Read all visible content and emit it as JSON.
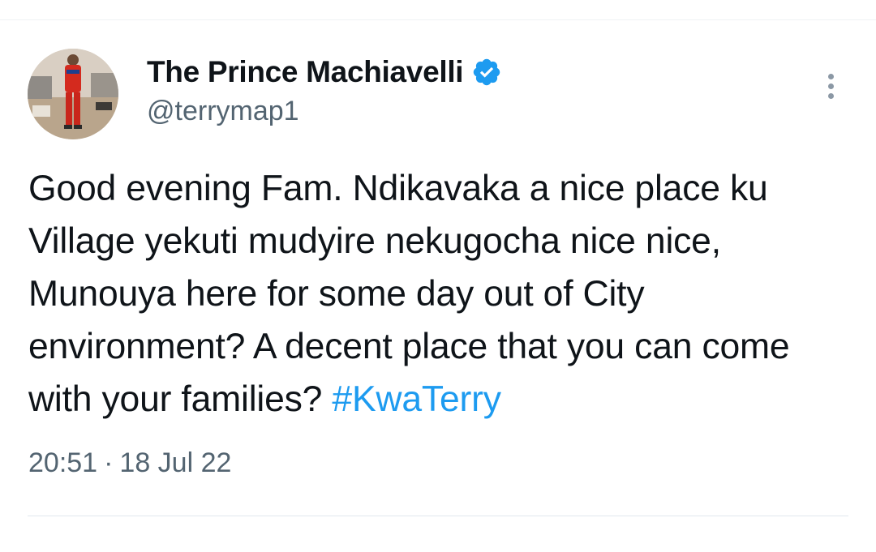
{
  "tweet": {
    "author": {
      "display_name": "The Prince Machiavelli",
      "handle": "@terrymap1",
      "verified": true,
      "verified_color": "#1d9bf0"
    },
    "text_parts": [
      "Good evening Fam. Ndikavaka a nice place ku Village yekuti mudyire nekugocha nice nice, Munouya here for some day out of City environment? A decent place that you can come with your families? "
    ],
    "hashtag": "#KwaTerry",
    "time": "20:51",
    "separator": "·",
    "date": "18 Jul 22",
    "more_icon": "more-vertical-icon"
  },
  "colors": {
    "text": "#0f1419",
    "secondary": "#536471",
    "link": "#1d9bf0"
  }
}
